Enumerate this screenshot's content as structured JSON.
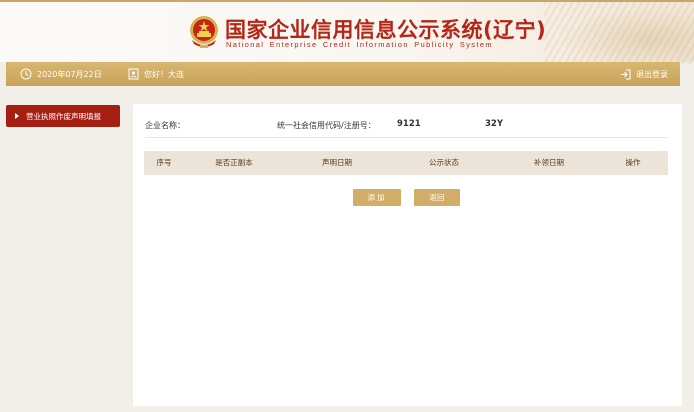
{
  "header": {
    "title_cn": "国家企业信用信息公示系统",
    "title_province": "(辽宁)",
    "title_en": "National Enterprise Credit Information Publicity System"
  },
  "topbar": {
    "date": "2020年07月22日",
    "greeting": "您好！大连",
    "logout_label": "退出登录"
  },
  "sidebar": {
    "items": [
      {
        "label": "营业执照作废声明填报"
      }
    ]
  },
  "main": {
    "company_label": "企业名称：",
    "company_value": "",
    "code_label": "统一社会信用代码/注册号：",
    "code_part1": "9121",
    "code_part2": "32Y",
    "table": {
      "columns": [
        "序号",
        "是否正副本",
        "声明日期",
        "公示状态",
        "补领日期",
        "操作"
      ],
      "rows": []
    },
    "buttons": {
      "add": "添加",
      "back": "返回"
    }
  },
  "colors": {
    "brand_red": "#b52616",
    "gold": "#c9a25a",
    "sidebar_red": "#a51f13"
  }
}
